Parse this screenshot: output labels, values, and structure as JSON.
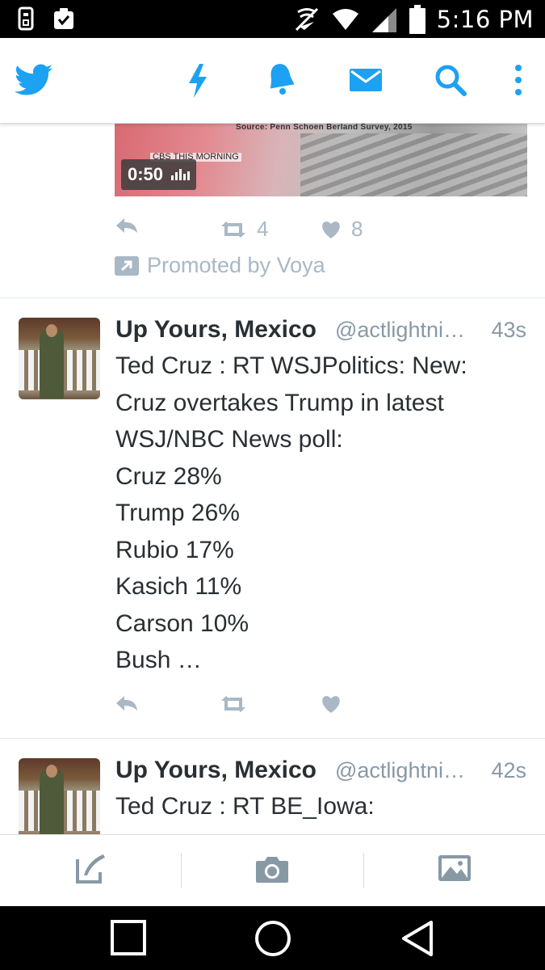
{
  "status_bar": {
    "time": "5:16 PM",
    "left_icons": [
      "sim-icon",
      "clipboard-check-icon"
    ],
    "right_icons": [
      "nfc-off-icon",
      "wifi-icon",
      "cell-signal-icon",
      "battery-icon"
    ]
  },
  "top_bar": {
    "icons": [
      "twitter-bird-icon",
      "lightning-icon",
      "notifications-bell-icon",
      "messages-envelope-icon",
      "search-icon",
      "overflow-menu-icon"
    ],
    "accent": "#1da1f2"
  },
  "promoted_tweet": {
    "media_source_text": "Source: Penn Schoen Berland Survey, 2015",
    "media_overlay_text": "CBS THIS MORNING",
    "video_duration": "0:50",
    "retweet_count": "4",
    "like_count": "8",
    "promoted_label": "Promoted by Voya"
  },
  "tweets": [
    {
      "name": "Up Yours, Mexico",
      "handle": "@actlightni…",
      "time": "43s",
      "text": "Ted Cruz : RT WSJPolitics: New:\nCruz overtakes Trump in latest\nWSJ/NBC News poll:\nCruz 28%\nTrump 26%\nRubio 17%\nKasich 11%\nCarson 10%\nBush …"
    },
    {
      "name": "Up Yours, Mexico",
      "handle": "@actlightni…",
      "time": "42s",
      "text": "Ted Cruz : RT BE_Iowa:"
    }
  ],
  "bottom_bar": {
    "icons": [
      "compose-tweet-icon",
      "camera-icon",
      "photo-gallery-icon"
    ]
  },
  "nav_bar": {
    "icons": [
      "recents-square-icon",
      "home-circle-icon",
      "back-triangle-icon"
    ]
  },
  "colors": {
    "twitter_blue": "#1da1f2",
    "muted_icon": "#a9b8c4",
    "handle_gray": "#8899a6",
    "text": "#292f33"
  }
}
